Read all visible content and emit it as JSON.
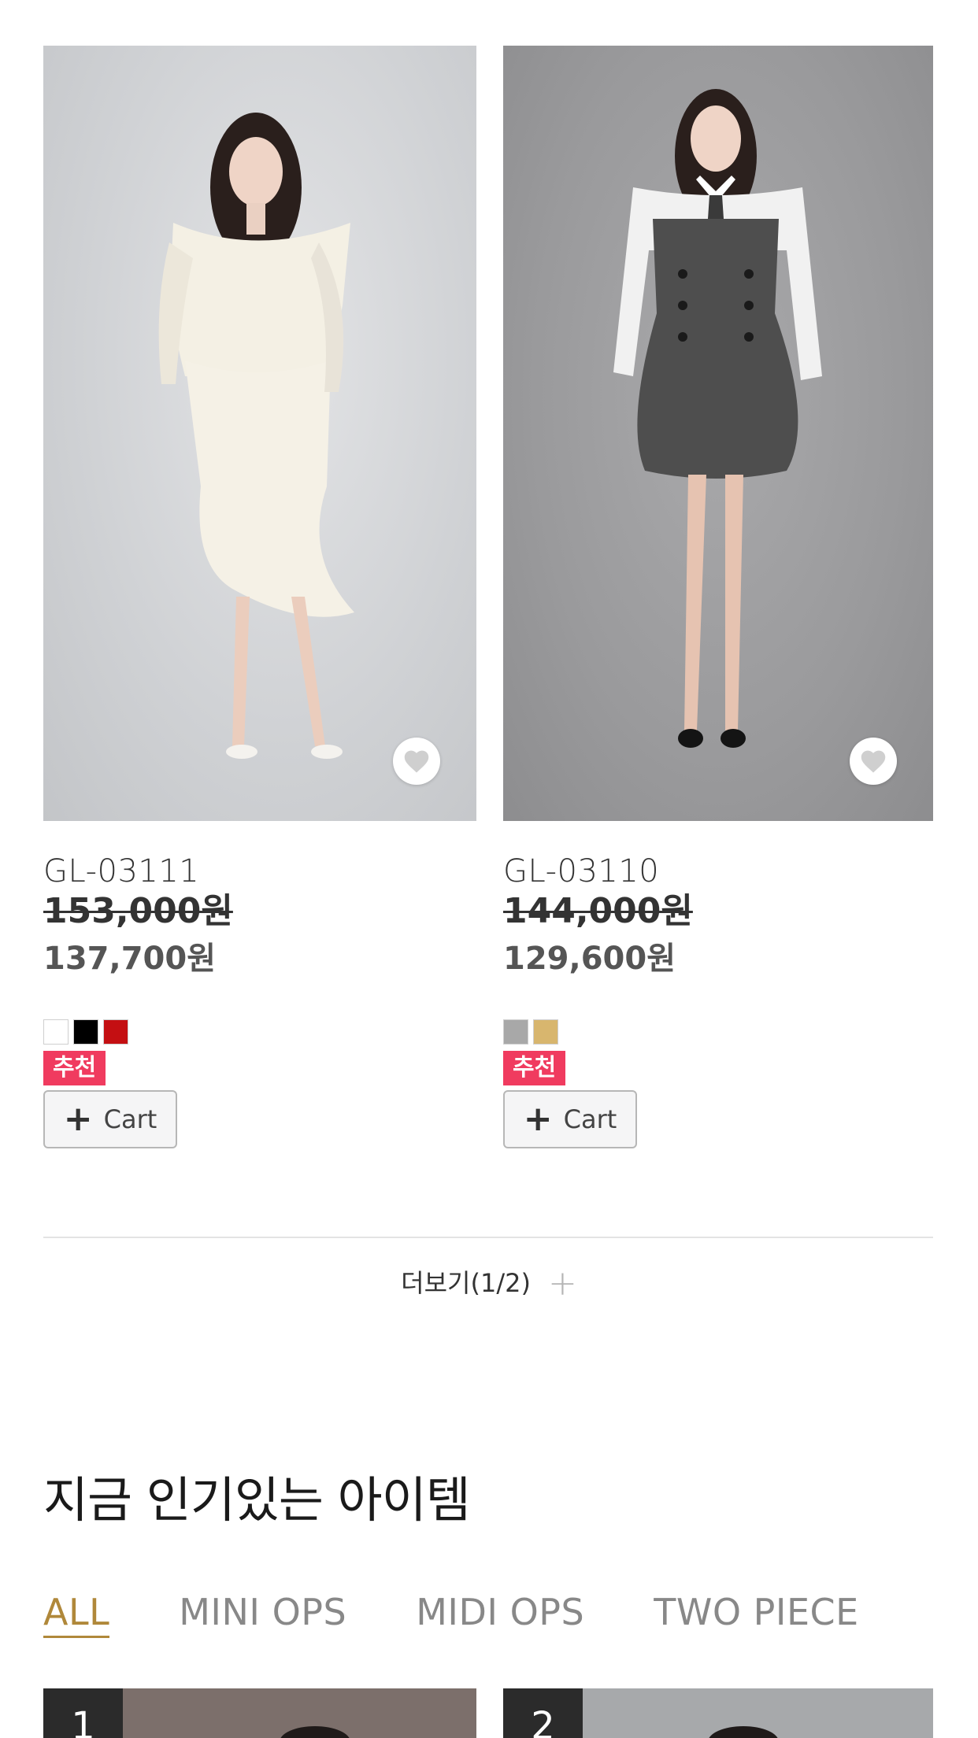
{
  "products": [
    {
      "code": "GL-03111",
      "original_price": "153,000원",
      "sale_price": "137,700원",
      "colors": [
        "#ffffff",
        "#000000",
        "#c40f12"
      ],
      "badge": "추천",
      "cart_label": "Cart",
      "icons": {
        "wishlist": "heart-icon",
        "cart": "plus-icon"
      }
    },
    {
      "code": "GL-03110",
      "original_price": "144,000원",
      "sale_price": "129,600원",
      "colors": [
        "#a8a8a8",
        "#d8b66e"
      ],
      "badge": "추천",
      "cart_label": "Cart",
      "icons": {
        "wishlist": "heart-icon",
        "cart": "plus-icon"
      }
    }
  ],
  "load_more": {
    "label": "더보기(1/2)",
    "icon": "plus-icon"
  },
  "popular": {
    "title": "지금 인기있는 아이템",
    "tabs": [
      "ALL",
      "MINI OPS",
      "MIDI OPS",
      "TWO PIECE"
    ],
    "active_tab": "ALL",
    "ranks": [
      "1",
      "2"
    ]
  }
}
